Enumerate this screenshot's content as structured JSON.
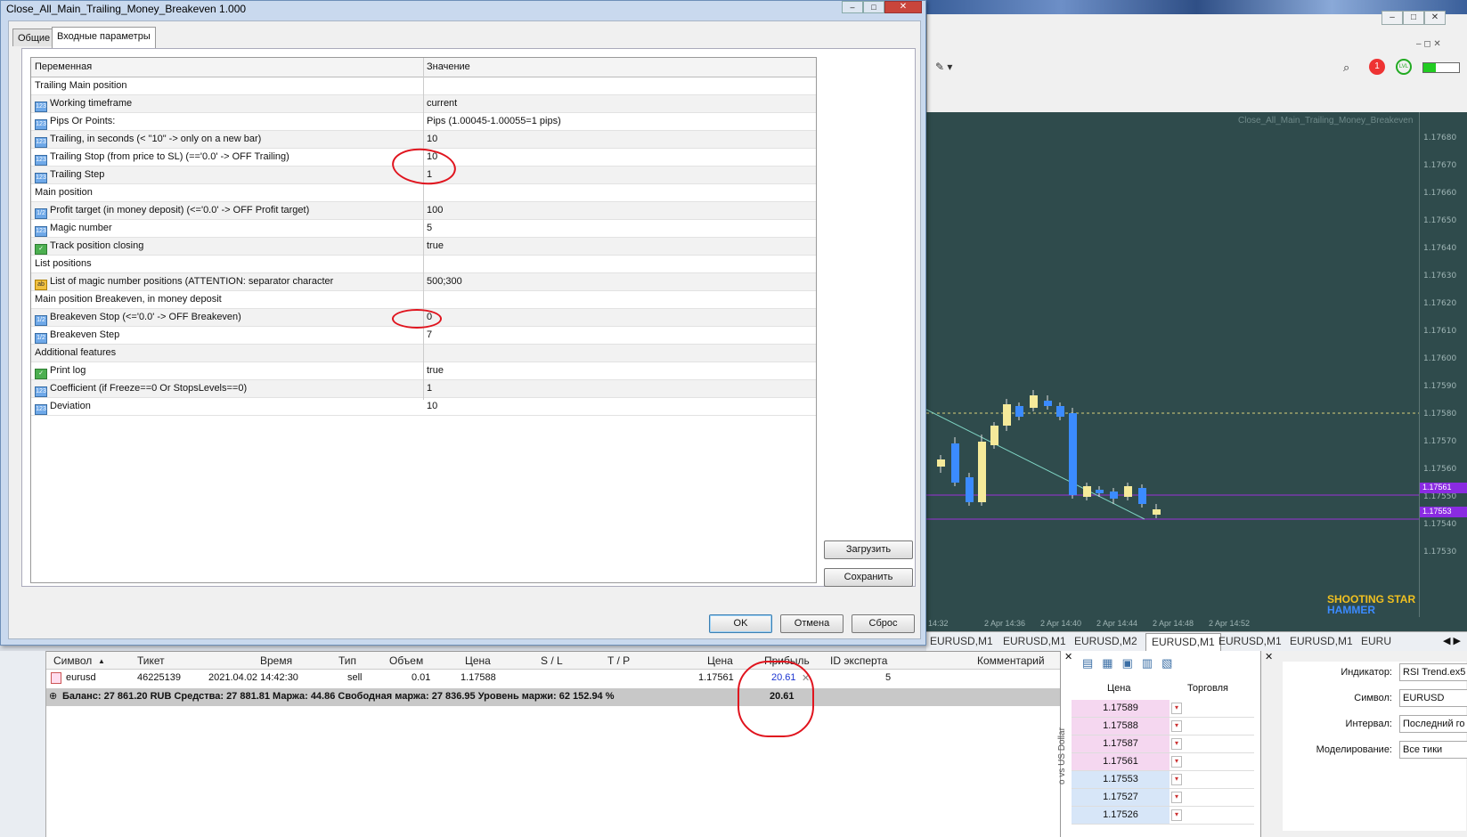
{
  "dialog": {
    "title": "Close_All_Main_Trailing_Money_Breakeven 1.000",
    "tabs": [
      "Общие",
      "Входные параметры"
    ],
    "columns": {
      "variable": "Переменная",
      "value": "Значение"
    },
    "params": [
      {
        "name": "Trailing Main position",
        "value": "",
        "icon": "",
        "group": true
      },
      {
        "name": "Working timeframe",
        "value": "current",
        "icon": "123"
      },
      {
        "name": "Pips Or Points:",
        "value": "Pips (1.00045-1.00055=1 pips)",
        "icon": "123"
      },
      {
        "name": "Trailing, in seconds (< \"10\" -> only on a new bar)",
        "value": "10",
        "icon": "123"
      },
      {
        "name": "Trailing Stop (from price to SL) (=='0.0' -> OFF Trailing)",
        "value": "10",
        "icon": "123"
      },
      {
        "name": "Trailing Step",
        "value": "1",
        "icon": "123"
      },
      {
        "name": "Main position",
        "value": "",
        "icon": "",
        "group": true
      },
      {
        "name": "Profit target (in money deposit) (<='0.0' -> OFF Profit target)",
        "value": "100",
        "icon": "1/2"
      },
      {
        "name": "Magic number",
        "value": "5",
        "icon": "123"
      },
      {
        "name": "Track position closing",
        "value": "true",
        "icon": "bool"
      },
      {
        "name": "List positions",
        "value": "",
        "icon": "",
        "group": true
      },
      {
        "name": "List of magic number positions (ATTENTION: separator character",
        "value": "500;300",
        "icon": "ab"
      },
      {
        "name": "Main position Breakeven, in money deposit",
        "value": "",
        "icon": "",
        "group": true
      },
      {
        "name": "Breakeven Stop (<='0.0' -> OFF Breakeven)",
        "value": "0",
        "icon": "1/2"
      },
      {
        "name": "Breakeven Step",
        "value": "7",
        "icon": "1/2"
      },
      {
        "name": "Additional features",
        "value": "",
        "icon": "",
        "group": true
      },
      {
        "name": "Print log",
        "value": "true",
        "icon": "bool"
      },
      {
        "name": "Coefficient (if Freeze==0 Or StopsLevels==0)",
        "value": "1",
        "icon": "123"
      },
      {
        "name": "Deviation",
        "value": "10",
        "icon": "123"
      }
    ],
    "buttons": {
      "load": "Загрузить",
      "save": "Сохранить",
      "ok": "OK",
      "cancel": "Отмена",
      "reset": "Сброс"
    }
  },
  "chart": {
    "expert_label": "Close_All_Main_Trailing_Money_Breakeven",
    "pattern_labels": [
      "SHOOTING STAR",
      "HAMMER"
    ],
    "chart_data": {
      "type": "candlestick",
      "y_ticks": [
        "1.17680",
        "1.17670",
        "1.17660",
        "1.17650",
        "1.17640",
        "1.17630",
        "1.17620",
        "1.17610",
        "1.17600",
        "1.17590",
        "1.17580",
        "1.17570",
        "1.17560",
        "1.17550",
        "1.17540",
        "1.17530"
      ],
      "x_ticks": [
        "14:32",
        "2 Apr 14:36",
        "2 Apr 14:40",
        "2 Apr 14:44",
        "2 Apr 14:48",
        "2 Apr 14:52"
      ]
    },
    "tabs": [
      "EURUSD,M1",
      "EURUSD,M1",
      "EURUSD,M2",
      "EURUSD,M1",
      "EURUSD,M1",
      "EURUSD,M1",
      "EURU"
    ]
  },
  "terminal": {
    "headers": [
      "Символ",
      "Тикет",
      "Время",
      "Тип",
      "Объем",
      "Цена",
      "S / L",
      "T / P",
      "Цена",
      "Прибыль",
      "ID эксперта",
      "Комментарий"
    ],
    "row": {
      "symbol": "eurusd",
      "ticket": "46225139",
      "time": "2021.04.02 14:42:30",
      "type": "sell",
      "volume": "0.01",
      "price": "1.17588",
      "sl": "",
      "tp": "",
      "cur_price": "1.17561",
      "profit": "20.61",
      "magic": "5",
      "comment": ""
    },
    "balance_line": "Баланс: 27 861.20 RUB  Средства: 27 881.81  Маржа: 44.86  Свободная маржа: 27 836.95  Уровень маржи: 62 152.94 %",
    "total_profit": "20.61"
  },
  "dom": {
    "headers": {
      "price": "Цена",
      "trade": "Торговля"
    },
    "prices": [
      "1.17589",
      "1.17588",
      "1.17587",
      "1.17561",
      "1.17553",
      "1.17527",
      "1.17526"
    ],
    "side_label": "o vs US Dollar"
  },
  "tester": {
    "labels": {
      "indicator": "Индикатор:",
      "symbol": "Символ:",
      "interval": "Интервал:",
      "model": "Моделирование:"
    },
    "values": {
      "indicator": "RSI Trend.ex5",
      "symbol": "EURUSD",
      "interval": "Последний го",
      "model": "Все тики"
    }
  }
}
